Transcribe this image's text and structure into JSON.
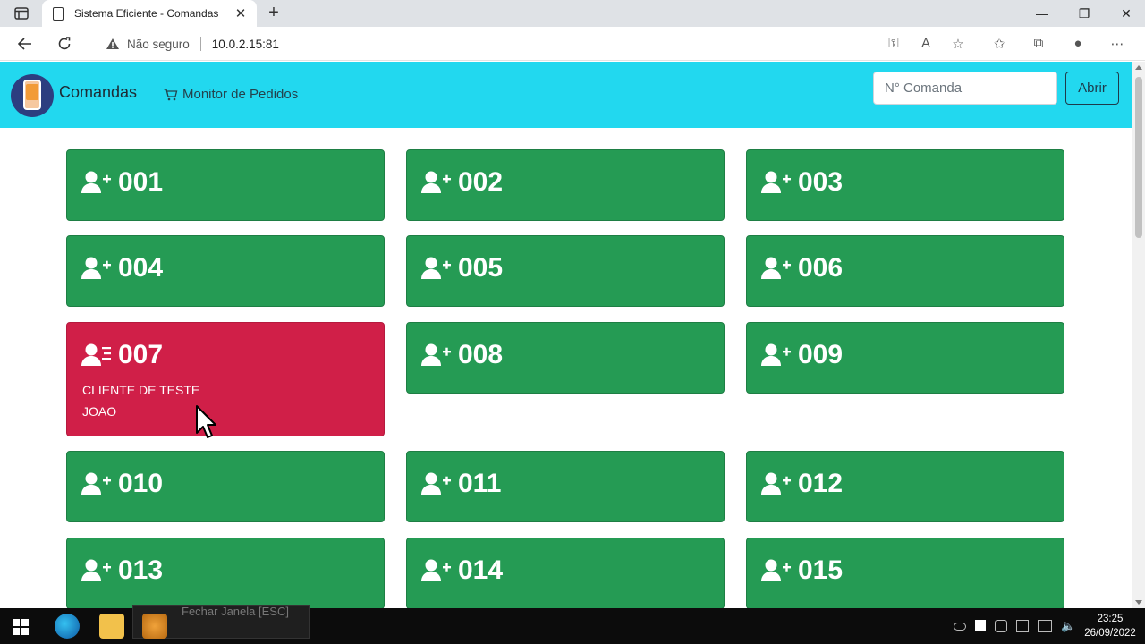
{
  "browser": {
    "tab_title": "Sistema Eficiente - Comandas",
    "tab_close": "✕",
    "new_tab": "+",
    "security_label": "Não seguro",
    "url": "10.0.2.15:81",
    "window_controls": [
      "—",
      "❐",
      "✕"
    ]
  },
  "navbar": {
    "brand": "Comandas",
    "monitor_link": "Monitor de Pedidos",
    "search_placeholder": "N° Comanda",
    "open_button": "Abrir",
    "background_color": "#22d8ef"
  },
  "comandas": [
    {
      "number": "001",
      "status": "free"
    },
    {
      "number": "002",
      "status": "free"
    },
    {
      "number": "003",
      "status": "free"
    },
    {
      "number": "004",
      "status": "free"
    },
    {
      "number": "005",
      "status": "free"
    },
    {
      "number": "006",
      "status": "free"
    },
    {
      "number": "007",
      "status": "busy",
      "client": "CLIENTE DE TESTE",
      "waiter": "JOAO"
    },
    {
      "number": "008",
      "status": "free"
    },
    {
      "number": "009",
      "status": "free"
    },
    {
      "number": "010",
      "status": "free"
    },
    {
      "number": "011",
      "status": "free"
    },
    {
      "number": "012",
      "status": "free"
    },
    {
      "number": "013",
      "status": "free"
    },
    {
      "number": "014",
      "status": "free"
    },
    {
      "number": "015",
      "status": "free"
    }
  ],
  "colors": {
    "free": "#259b54",
    "busy": "#d01f48"
  },
  "taskbar": {
    "tooltip": "Fechar Janela [ESC]",
    "time": "23:25",
    "date": "26/09/2022"
  }
}
